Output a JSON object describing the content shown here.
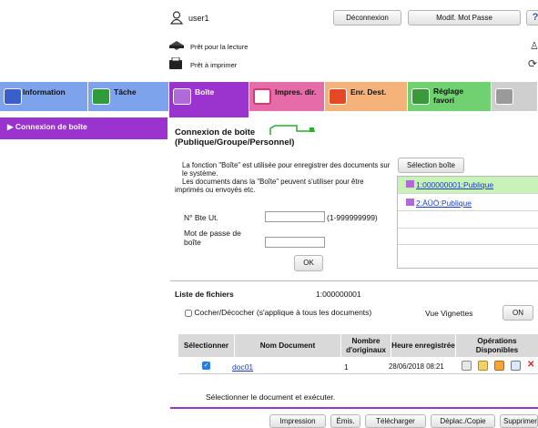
{
  "user": {
    "name": "user1"
  },
  "top_buttons": {
    "logout": "Déconnexion",
    "change_pw": "Modif. Mot Passe",
    "help": "?"
  },
  "status": {
    "ready_read": "Prêt pour la lecture",
    "ready_print": "Prêt à imprimer"
  },
  "tabs": [
    {
      "label": "Information",
      "color": "#7ca3ec",
      "icon_color": "#3a5fcc"
    },
    {
      "label": "Tâche",
      "color": "#7ca3ec",
      "icon_color": "#2e9c3c"
    },
    {
      "label": "Boîte",
      "color": "#9b33ce",
      "icon_color": "#b06ad8"
    },
    {
      "label": "Impres. dir.",
      "color": "#e56ca8",
      "icon_color": "#d43a70"
    },
    {
      "label": "Enr. Dest.",
      "color": "#f5b27a",
      "icon_color": "#e34a23"
    },
    {
      "label": "Réglage\nfavori",
      "color": "#6fd16f",
      "icon_color": "#3a9a3a"
    },
    {
      "label": "",
      "color": "#cfcfcf",
      "icon_color": "#9a9a9a"
    }
  ],
  "sidebar": {
    "item": "Connexion de boîte"
  },
  "box_login": {
    "title_line1": "Connexion de boîte",
    "title_line2": "(Publique/Groupe/Personnel)",
    "desc1": "La fonction \"Boîte\" est utilisée pour enregistrer des documents sur le système.",
    "desc2": "Les documents dans la \"Boîte\" peuvent s'utiliser pour être imprimés ou envoyés etc.",
    "box_no_label": "N° Bte Ut.",
    "box_no_value": "",
    "box_no_range": "(1-999999999)",
    "password_label": "Mot de passe de boîte",
    "password_value": "",
    "ok": "OK",
    "select_box": "Sélection boîte",
    "boxes": [
      "1:000000001:Publique",
      "2:ÄÜÖ:Publique"
    ]
  },
  "file_list": {
    "title": "Liste de fichiers",
    "box_id": "1:000000001",
    "check_all": "Cocher/Décocher (s'applique à tous les documents)",
    "thumb_view": "Vue Vignettes",
    "thumb_on": "ON",
    "headers": {
      "select": "Sélectionner",
      "doc_name": "Nom Document",
      "originals": "Nombre d'originaux",
      "time": "Heure enregistrée",
      "ops": "Opérations Disponibles"
    },
    "rows": [
      {
        "name": "doc01",
        "originals": "1",
        "time": "28/06/2018 08:21",
        "checked": true
      }
    ],
    "hint": "Sélectionner le document et exécuter."
  },
  "bottom_buttons": {
    "print": "Impression",
    "send": "Émis.",
    "download": "Télécharger",
    "move_copy": "Déplac./Copie",
    "delete": "Supprimer"
  }
}
